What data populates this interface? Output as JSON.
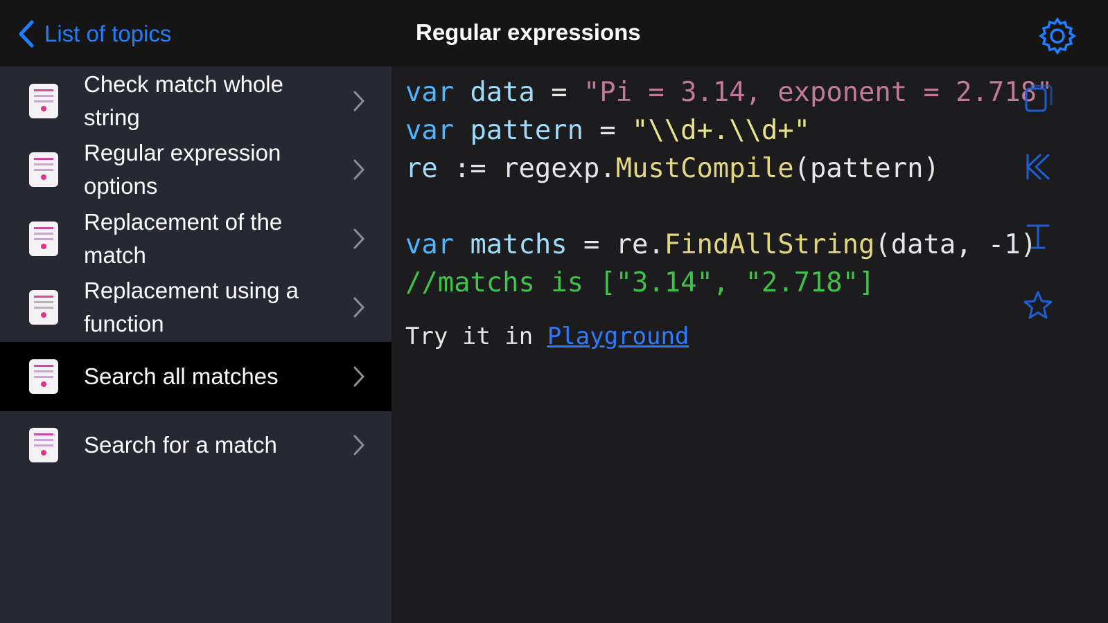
{
  "nav": {
    "back_label": "List of topics",
    "title": "Regular expressions",
    "settings_icon": "gear-icon"
  },
  "sidebar": {
    "items": [
      {
        "label": "Check match whole string",
        "selected": false,
        "icon": "code-file-icon"
      },
      {
        "label": "Regular expression options",
        "selected": false,
        "icon": "code-file-icon"
      },
      {
        "label": "Replacement of the match",
        "selected": false,
        "icon": "code-file-icon"
      },
      {
        "label": "Replacement using a function",
        "selected": false,
        "icon": "code-file-icon"
      },
      {
        "label": "Search all matches",
        "selected": true,
        "icon": "code-file-icon"
      },
      {
        "label": "Search for a match",
        "selected": false,
        "icon": "code-file-icon"
      }
    ]
  },
  "code": {
    "l1_kw": "var",
    "l1_var": "data",
    "l1_op": " = ",
    "l1_str": "\"Pi = 3.14, exponent = 2.718\"",
    "l2_kw": "var",
    "l2_var": "pattern",
    "l2_op": " = ",
    "l2_str": "\"\\\\d+.\\\\d+\"",
    "l3_var": "re",
    "l3_op": " := regexp.",
    "l3_fn": "MustCompile",
    "l3_rest": "(pattern)",
    "l5_kw": "var",
    "l5_var": "matchs",
    "l5_op": " = re.",
    "l5_fn": "FindAllString",
    "l5_rest": "(data, -1)",
    "l6_comment": "//matchs is [\"3.14\", \"2.718\"]"
  },
  "try": {
    "prefix": "Try it in ",
    "link": "Playground"
  },
  "tools": [
    "copy-icon",
    "run-icon",
    "font-size-icon",
    "star-icon"
  ],
  "colors": {
    "accent": "#1f7fff",
    "sidebar_bg": "#262833",
    "selected_bg": "#000000",
    "code_bg": "#1c1c1e"
  }
}
